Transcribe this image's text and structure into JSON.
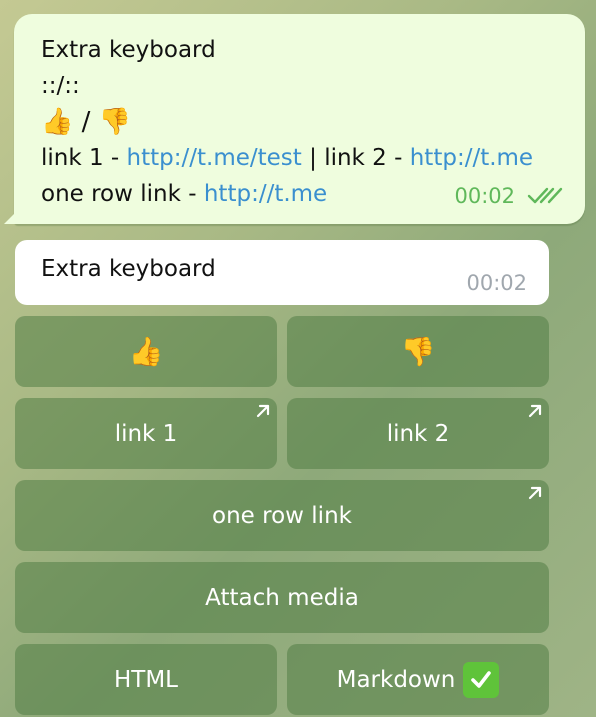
{
  "outgoing_message": {
    "title": "Extra keyboard",
    "separator": "::/::",
    "emoji_up": "👍",
    "emoji_slash": " / ",
    "emoji_down": "👎",
    "link1_label": "link 1 - ",
    "link1_url": "http://t.me/test",
    "divider": " | ",
    "link2_label": "link 2 - ",
    "link2_url": "http://t.me",
    "row_link_label": "one row link - ",
    "row_link_url": "http://t.me",
    "time": "00:02",
    "read_status_icon": "double-check-icon"
  },
  "incoming_message": {
    "text": "Extra keyboard",
    "time": "00:02"
  },
  "keyboard": {
    "rows": [
      [
        {
          "label": "👍",
          "icon": "thumbs-up-icon"
        },
        {
          "label": "👎",
          "icon": "thumbs-down-icon"
        }
      ],
      [
        {
          "label": "link 1",
          "external": true
        },
        {
          "label": "link 2",
          "external": true
        }
      ],
      [
        {
          "label": "one row link",
          "external": true
        }
      ],
      [
        {
          "label": "Attach media"
        }
      ],
      [
        {
          "label": "HTML"
        },
        {
          "label": "Markdown",
          "icon": "check-mark-button-icon"
        }
      ]
    ]
  },
  "colors": {
    "outgoing_bubble": "#effdde",
    "link": "#3a8fcf",
    "outgoing_time": "#5fb85a",
    "incoming_time": "#a0a7ae",
    "button_bg": "#6f9560",
    "check_green": "#5fc33a"
  }
}
